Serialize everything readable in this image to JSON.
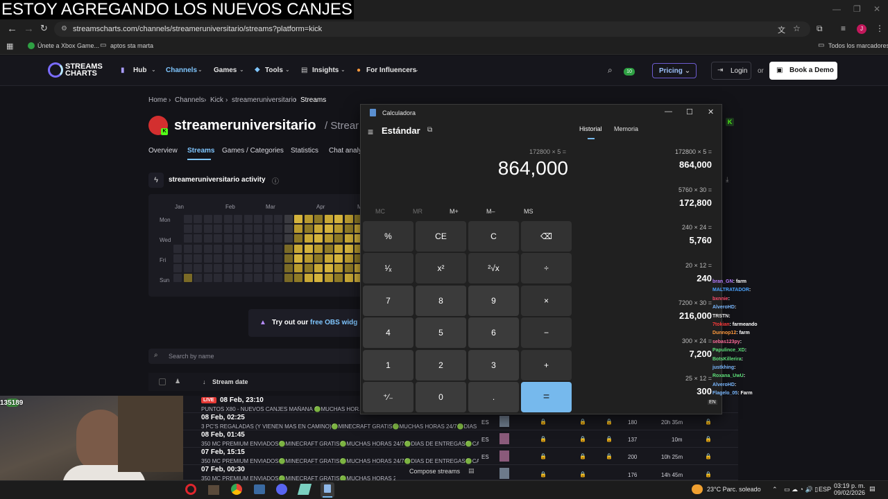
{
  "caption": "ESTOY AGREGANDO LOS NUEVOS CANJES",
  "browser": {
    "url": "streamscharts.com/channels/streameruniversitario/streams?platform=kick",
    "bookmarks": [
      "Únete a Xbox Game...",
      "aptos sta marta"
    ],
    "bookmarks_right": "Todos los marcadores",
    "profile_initial": "J"
  },
  "site": {
    "logo": [
      "STREAMS",
      "CHARTS"
    ],
    "nav": [
      "Hub",
      "Channels",
      "Games",
      "Tools",
      "Insights",
      "For Influencers"
    ],
    "live_badge": "10",
    "pricing": "Pricing",
    "login": "Login",
    "or": "or",
    "demo": "Book a Demo",
    "breadcrumb": [
      "Home",
      "Channels",
      "Kick",
      "streameruniversitario",
      "Streams"
    ],
    "channel_name": "streameruniversitario",
    "channel_suffix": "/ Strear",
    "tabs": [
      "Overview",
      "Streams",
      "Games / Categories",
      "Statistics",
      "Chat analy"
    ],
    "activity_title": "streameruniversitario activity",
    "months": [
      "Jan",
      "Feb",
      "Mar",
      "Apr",
      "M"
    ],
    "days": [
      "Mon",
      "Wed",
      "Fri",
      "Sun"
    ],
    "obs_prefix": "Try out our ",
    "obs_link": "free OBS widg",
    "search_placeholder": "Search by name",
    "col_stream_date": "Stream date",
    "compose": "Compose streams",
    "streams": [
      {
        "live": "LIVE",
        "date": "08 Feb, 23:10",
        "title": "PUNTOS X80 - NUEVOS CANJES MAÑANA 🟢MUCHAS HORAS",
        "lang": "",
        "viewers": "",
        "duration": ""
      },
      {
        "live": "",
        "date": "08 Feb, 02:25",
        "title": "3 PC'S REGALADAS (Y VIENEN MAS EN CAMINO)🟢MINECRAFT GRATIS🟢MUCHAS HORAS 24/7🟢DIAS DE",
        "lang": "ES",
        "viewers": "180",
        "duration": "20h 35m"
      },
      {
        "live": "",
        "date": "08 Feb, 01:45",
        "title": "350 MC PREMIUM ENVIADOS🟢MINECRAFT GRATIS🟢MUCHAS HORAS 24/7🟢DIAS DE ENTREGAS🟢CA",
        "lang": "ES",
        "viewers": "137",
        "duration": "10m"
      },
      {
        "live": "",
        "date": "07 Feb, 15:15",
        "title": "350 MC PREMIUM ENVIADOS🟢MINECRAFT GRATIS🟢MUCHAS HORAS 24/7🟢DIAS DE ENTREGAS🟢CA",
        "lang": "ES",
        "viewers": "200",
        "duration": "10h 25m"
      },
      {
        "live": "",
        "date": "07 Feb, 00:30",
        "title": "350 MC PREMIUM ENVIADOS🟢MINECRAFT GRATIS🟢MUCHAS HORAS 24/7🟢DIAS DE ENTREGAS🟢CA",
        "lang": "ES",
        "viewers": "176",
        "duration": "14h 45m"
      }
    ]
  },
  "calculator": {
    "window_title": "Calculadora",
    "mode": "Estándar",
    "expression": "172800 × 5 =",
    "display": "864,000",
    "memory": [
      "MC",
      "MR",
      "M+",
      "M–",
      "MS"
    ],
    "keys": [
      "%",
      "CE",
      "C",
      "⌫",
      "¹⁄ₓ",
      "x²",
      "²√x",
      "÷",
      "7",
      "8",
      "9",
      "×",
      "4",
      "5",
      "6",
      "−",
      "1",
      "2",
      "3",
      "+",
      "⁺⁄₋",
      "0",
      ".",
      "="
    ],
    "tabs": [
      "Historial",
      "Memoria"
    ],
    "history": [
      {
        "expr": "172800  ×  5 =",
        "result": "864,000"
      },
      {
        "expr": "5760  ×  30 =",
        "result": "172,800"
      },
      {
        "expr": "240  ×  24 =",
        "result": "5,760"
      },
      {
        "expr": "20  ×  12 =",
        "result": "240"
      },
      {
        "expr": "7200  ×  30 =",
        "result": "216,000"
      },
      {
        "expr": "300  ×  24 =",
        "result": "7,200"
      },
      {
        "expr": "25  ×  12 =",
        "result": "300"
      }
    ]
  },
  "chat": [
    {
      "user": "bran_GN",
      "msg": ": farm",
      "color": "#b57cff"
    },
    {
      "user": "MALTRATADOR",
      "msg": ":",
      "color": "#4aa3ff"
    },
    {
      "user": "bxnnie",
      "msg": ":",
      "color": "#ff4d6d"
    },
    {
      "user": "AlveroHD",
      "msg": ":",
      "color": "#7ab8ff"
    },
    {
      "user": "TRSTN",
      "msg": ":",
      "color": "#e8e8e8"
    },
    {
      "user": "7tokian",
      "msg": ": farmeando",
      "color": "#ff3b3b"
    },
    {
      "user": "Dunnop12",
      "msg": ": farm",
      "color": "#ff9a3c"
    },
    {
      "user": "sebas123py",
      "msg": ":",
      "color": "#ff6b9a"
    },
    {
      "user": "Papulince_XD",
      "msg": ":",
      "color": "#5ee07a"
    },
    {
      "user": "BotsKillerira",
      "msg": ":",
      "color": "#5ee07a"
    },
    {
      "user": "justkhing",
      "msg": ":",
      "color": "#7ab8ff"
    },
    {
      "user": "Roxana_UwU",
      "msg": ":",
      "color": "#5ee07a"
    },
    {
      "user": "AlveroHD",
      "msg": ":",
      "color": "#7ab8ff"
    },
    {
      "user": "Flagelo_05",
      "msg": ": Farm",
      "color": "#7ab8ff"
    }
  ],
  "webcam_counter": "135189",
  "taskbar": {
    "weather": "23°C  Parc. soleado",
    "lang": "ESP",
    "time": "03:19 p. m.",
    "date": "09/02/2026"
  }
}
